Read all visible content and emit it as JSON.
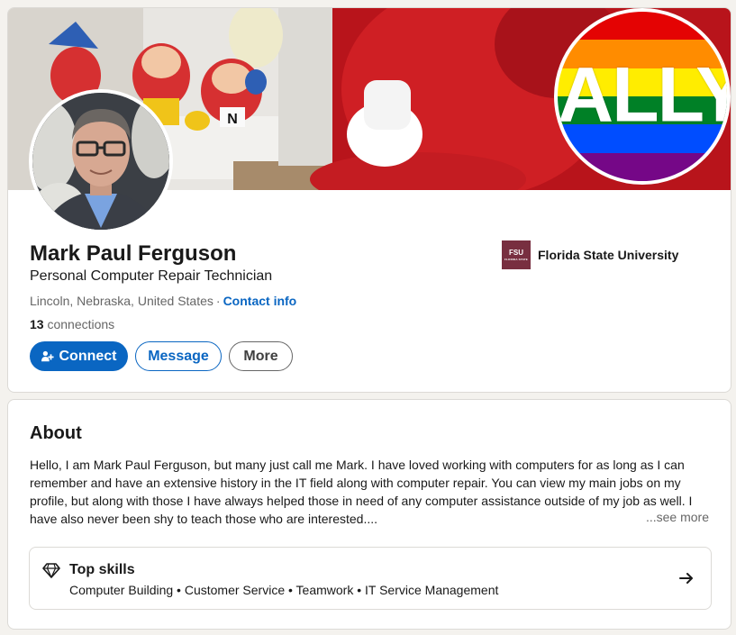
{
  "colors": {
    "accent": "#0a66c2",
    "fsu_garnet": "#782f40",
    "page_background": "#f4f2ee",
    "ally_stripes": [
      "#e40303",
      "#ff8c00",
      "#ffed00",
      "#008026",
      "#004dff",
      "#750787"
    ]
  },
  "banner": {
    "badge_text": "ALLY",
    "character_letter": "N"
  },
  "profile": {
    "name": "Mark Paul Ferguson",
    "headline": "Personal Computer Repair Technician",
    "location": "Lincoln, Nebraska, United States",
    "separator": "·",
    "contact_info_label": "Contact info",
    "connections_count": "13",
    "connections_label": " connections"
  },
  "actions": {
    "connect_label": "Connect",
    "message_label": "Message",
    "more_label": "More"
  },
  "education": {
    "logo_text": "FSU",
    "logo_subtext": "FLORIDA STATE",
    "school_name": "Florida State University"
  },
  "about": {
    "title": "About",
    "text": "Hello, I am Mark Paul Ferguson, but many just call me Mark. I have loved working with computers for as long as I can remember and have an extensive history in the IT field along with computer repair. You can view my main jobs on my profile, but along with those I have always helped those in need of any computer assistance outside of my job as well. I have also never been shy to teach those who are interested....",
    "see_more_label": "...see more"
  },
  "top_skills": {
    "title": "Top skills",
    "skills": "Computer Building • Customer Service • Teamwork • IT Service Management"
  },
  "icons": {
    "connect": "person-add-icon",
    "skills": "diamond-icon",
    "navigate": "arrow-right-icon"
  }
}
